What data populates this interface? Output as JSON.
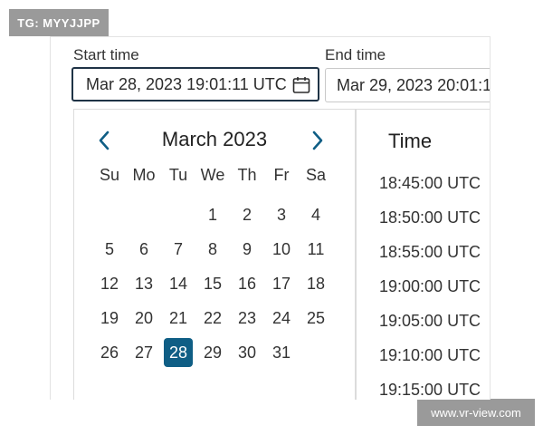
{
  "watermarks": {
    "top_left": "TG: MYYJJPP",
    "bottom_right": "www.vr-view.com"
  },
  "start": {
    "label": "Start time",
    "value": "Mar 28, 2023 19:01:11 UTC"
  },
  "end": {
    "label": "End time",
    "value": "Mar 29, 2023 20:01:1"
  },
  "calendar": {
    "month_title": "March 2023",
    "weekdays": [
      "Su",
      "Mo",
      "Tu",
      "We",
      "Th",
      "Fr",
      "Sa"
    ],
    "days": [
      "",
      "",
      "",
      "1",
      "2",
      "3",
      "4",
      "5",
      "6",
      "7",
      "8",
      "9",
      "10",
      "11",
      "12",
      "13",
      "14",
      "15",
      "16",
      "17",
      "18",
      "19",
      "20",
      "21",
      "22",
      "23",
      "24",
      "25",
      "26",
      "27",
      "28",
      "29",
      "30",
      "31"
    ],
    "selected_day": "28",
    "accent_color": "#0f5e85"
  },
  "time": {
    "title": "Time",
    "options": [
      "18:45:00 UTC",
      "18:50:00 UTC",
      "18:55:00 UTC",
      "19:00:00 UTC",
      "19:05:00 UTC",
      "19:10:00 UTC",
      "19:15:00 UTC"
    ]
  }
}
